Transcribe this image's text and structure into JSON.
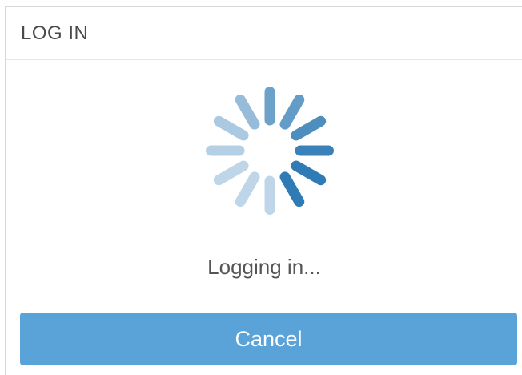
{
  "dialog": {
    "title": "LOG IN",
    "status_text": "Logging in...",
    "cancel_label": "Cancel"
  },
  "spinner": {
    "icon": "loading-spinner-icon",
    "color": "#2f7bb5"
  },
  "colors": {
    "button": "#5aa3d8",
    "title_text": "#4a4a4a",
    "status_text": "#555555"
  }
}
